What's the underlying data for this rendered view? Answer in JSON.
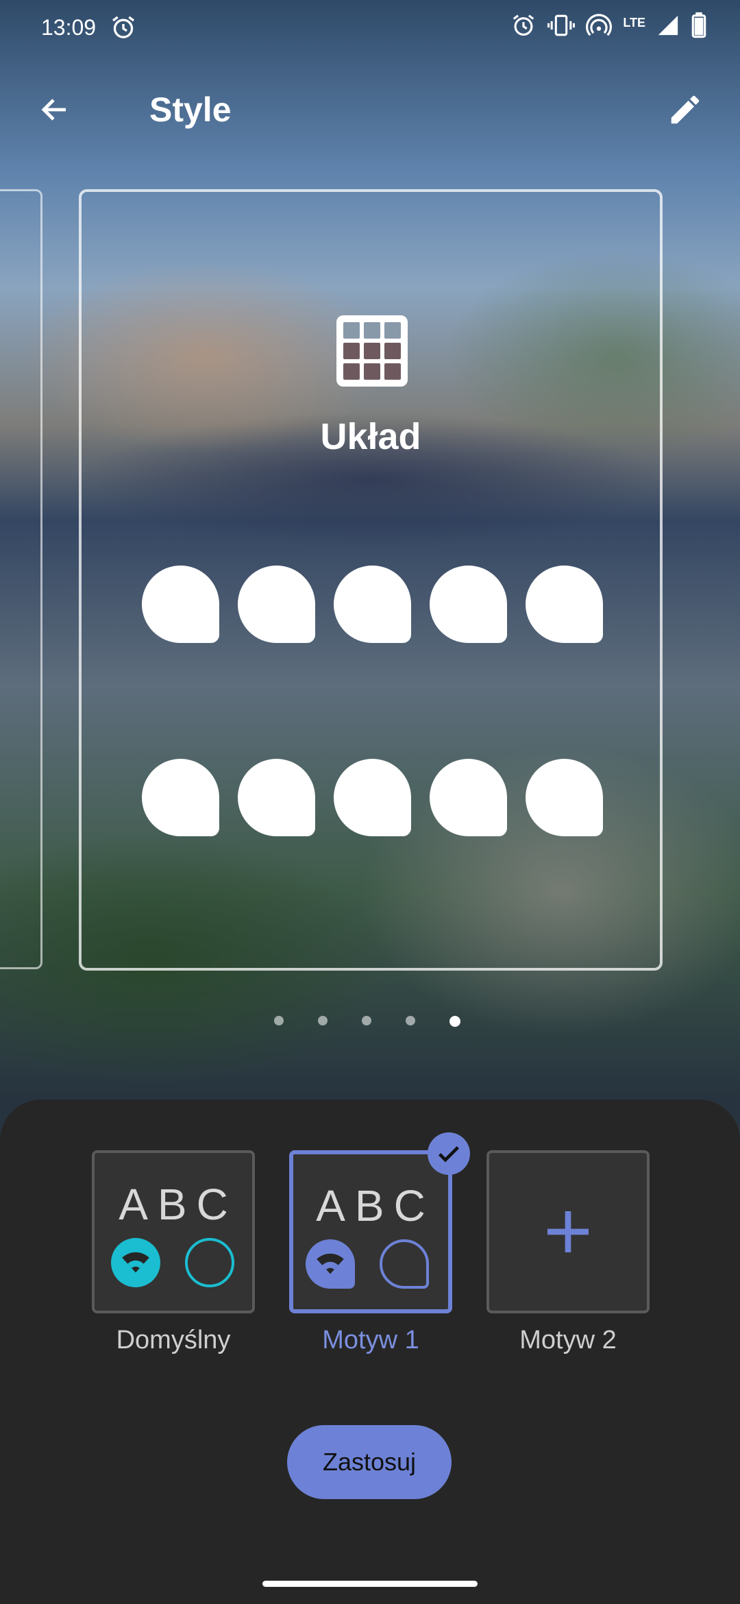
{
  "status_bar": {
    "time": "13:09",
    "network_label": "LTE",
    "icons": [
      "alarm-icon",
      "vibrate-icon",
      "hotspot-icon",
      "signal-icon",
      "battery-icon"
    ]
  },
  "app_bar": {
    "title": "Style",
    "back_icon": "arrow-back-icon",
    "edit_icon": "pencil-icon"
  },
  "preview": {
    "card_title": "Układ",
    "card_icon": "grid-icon",
    "shape_rows": 2,
    "shapes_per_row": 5,
    "page_count": 5,
    "active_page": 5
  },
  "styles": {
    "options": [
      {
        "label": "Domyślny",
        "letters": "ABC",
        "selected": false,
        "accent": "#1bbdd0"
      },
      {
        "label": "Motyw 1",
        "letters": "ABC",
        "selected": true,
        "accent": "#6d82d6"
      },
      {
        "label": "Motyw 2",
        "letters": "",
        "selected": false,
        "accent": "#6d82d6"
      }
    ],
    "apply_label": "Zastosuj"
  },
  "colors": {
    "accent": "#6d82d6",
    "sheet_background": "#262626",
    "teal": "#1bbdd0"
  }
}
